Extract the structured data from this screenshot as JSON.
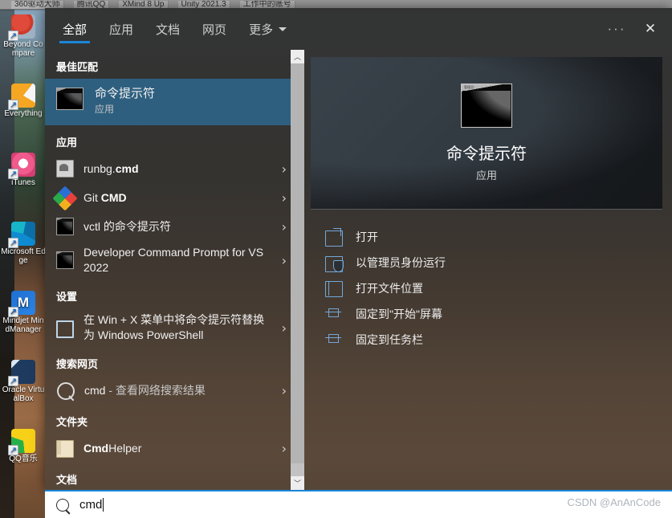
{
  "topstrip": {
    "items": [
      "360驱动大师",
      "腾讯QQ",
      "XMind 8 Up",
      "Unity 2021.3",
      "工作中的账号"
    ]
  },
  "desktop": {
    "icons": [
      {
        "label": "Beyond Compare",
        "icon": "beyond-compare-icon"
      },
      {
        "label": "Everything",
        "icon": "everything-icon"
      },
      {
        "label": "iTunes",
        "icon": "itunes-icon"
      },
      {
        "label": "Microsoft Edge",
        "icon": "edge-icon"
      },
      {
        "label": "Mindjet MindManager",
        "icon": "mindmanager-icon"
      },
      {
        "label": "Oracle VirtualBox",
        "icon": "virtualbox-icon"
      },
      {
        "label": "QQ音乐",
        "icon": "qqmusic-icon"
      }
    ]
  },
  "header": {
    "tabs": [
      {
        "label": "全部",
        "active": true
      },
      {
        "label": "应用",
        "active": false
      },
      {
        "label": "文档",
        "active": false
      },
      {
        "label": "网页",
        "active": false
      },
      {
        "label": "更多",
        "active": false,
        "has_caret": true
      }
    ],
    "more_button": "···",
    "close_button": "✕"
  },
  "results": {
    "groups": [
      {
        "title": "最佳匹配",
        "items": [
          {
            "title": "命令提示符",
            "subtitle": "应用",
            "icon": "console-icon",
            "selected": true,
            "chevron": ""
          }
        ]
      },
      {
        "title": "应用",
        "items": [
          {
            "title_plain": "runbg.",
            "title_bold": "cmd",
            "icon": "script-icon",
            "chevron": "›"
          },
          {
            "title_plain": "Git ",
            "title_bold": "CMD",
            "icon": "git-icon",
            "chevron": "›"
          },
          {
            "title": "vctl 的命令提示符",
            "icon": "console-icon",
            "chevron": "›"
          },
          {
            "title": "Developer Command Prompt for VS 2022",
            "icon": "console-icon",
            "chevron": "›"
          }
        ]
      },
      {
        "title": "设置",
        "items": [
          {
            "title": "在 Win + X 菜单中将命令提示符替换为 Windows PowerShell",
            "icon": "settings-icon",
            "chevron": "›"
          }
        ]
      },
      {
        "title": "搜索网页",
        "items": [
          {
            "title_plain": "cmd",
            "title_dim": " - 查看网络搜索结果",
            "icon": "search-icon",
            "chevron": "›"
          }
        ]
      },
      {
        "title": "文件夹",
        "items": [
          {
            "title_bold": "Cmd",
            "title_plain2": "Helper",
            "icon": "folder-icon",
            "chevron": "›"
          }
        ]
      },
      {
        "title": "文档",
        "items": []
      }
    ],
    "scrollbar": {
      "up_arrow": "︿",
      "down_arrow": "﹀"
    }
  },
  "preview": {
    "app_name": "命令提示符",
    "app_type": "应用",
    "icon": "console-icon-large",
    "icon_caption": "管理员:",
    "actions": [
      {
        "label": "打开",
        "icon": "open-icon"
      },
      {
        "label": "以管理员身份运行",
        "icon": "shield-run-icon"
      },
      {
        "label": "打开文件位置",
        "icon": "file-location-icon"
      },
      {
        "label": "固定到\"开始\"屏幕",
        "icon": "pin-icon"
      },
      {
        "label": "固定到任务栏",
        "icon": "pin-icon"
      }
    ]
  },
  "searchbar": {
    "value": "cmd",
    "icon": "search-icon",
    "accent_color": "#1a86d8"
  },
  "watermark": {
    "text": "CSDN @AnAnCode"
  }
}
